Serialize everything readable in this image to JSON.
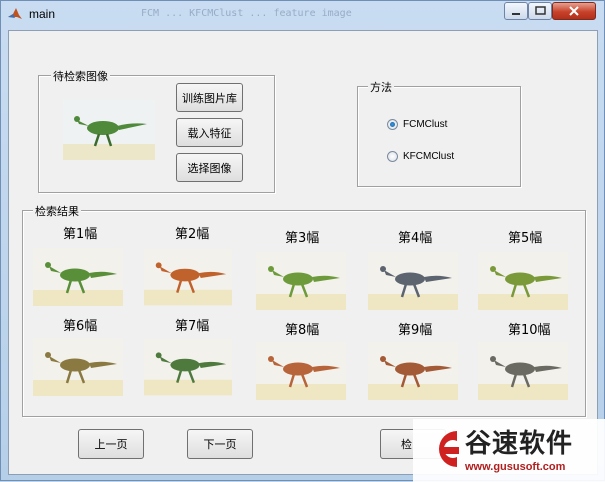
{
  "window": {
    "title": "main",
    "title_ghost": "FCM ... KFCMClust ... feature image"
  },
  "query_panel": {
    "label": "待检索图像",
    "buttons": {
      "train": "训练图片库",
      "load": "载入特征",
      "select": "选择图像"
    }
  },
  "method_panel": {
    "label": "方法",
    "options": [
      {
        "label": "FCMClust",
        "selected": true
      },
      {
        "label": "KFCMClust",
        "selected": false
      }
    ]
  },
  "results_panel": {
    "label": "检索结果",
    "items": [
      {
        "caption": "第1幅",
        "color": "#5a8f3a"
      },
      {
        "caption": "第2幅",
        "color": "#c0622c"
      },
      {
        "caption": "第3幅",
        "color": "#6d9b3c"
      },
      {
        "caption": "第4幅",
        "color": "#5c6470"
      },
      {
        "caption": "第5幅",
        "color": "#7a9a3a"
      },
      {
        "caption": "第6幅",
        "color": "#8a7a42"
      },
      {
        "caption": "第7幅",
        "color": "#4f7a3e"
      },
      {
        "caption": "第8幅",
        "color": "#b8643a"
      },
      {
        "caption": "第9幅",
        "color": "#a35a36"
      },
      {
        "caption": "第10幅",
        "color": "#6a6a62"
      }
    ]
  },
  "nav": {
    "prev": "上一页",
    "next": "下一页",
    "search": "检"
  },
  "watermark": {
    "text": "谷速软件",
    "url": "www.gususoft.com"
  },
  "query_image": {
    "color": "#4e8a3a"
  }
}
